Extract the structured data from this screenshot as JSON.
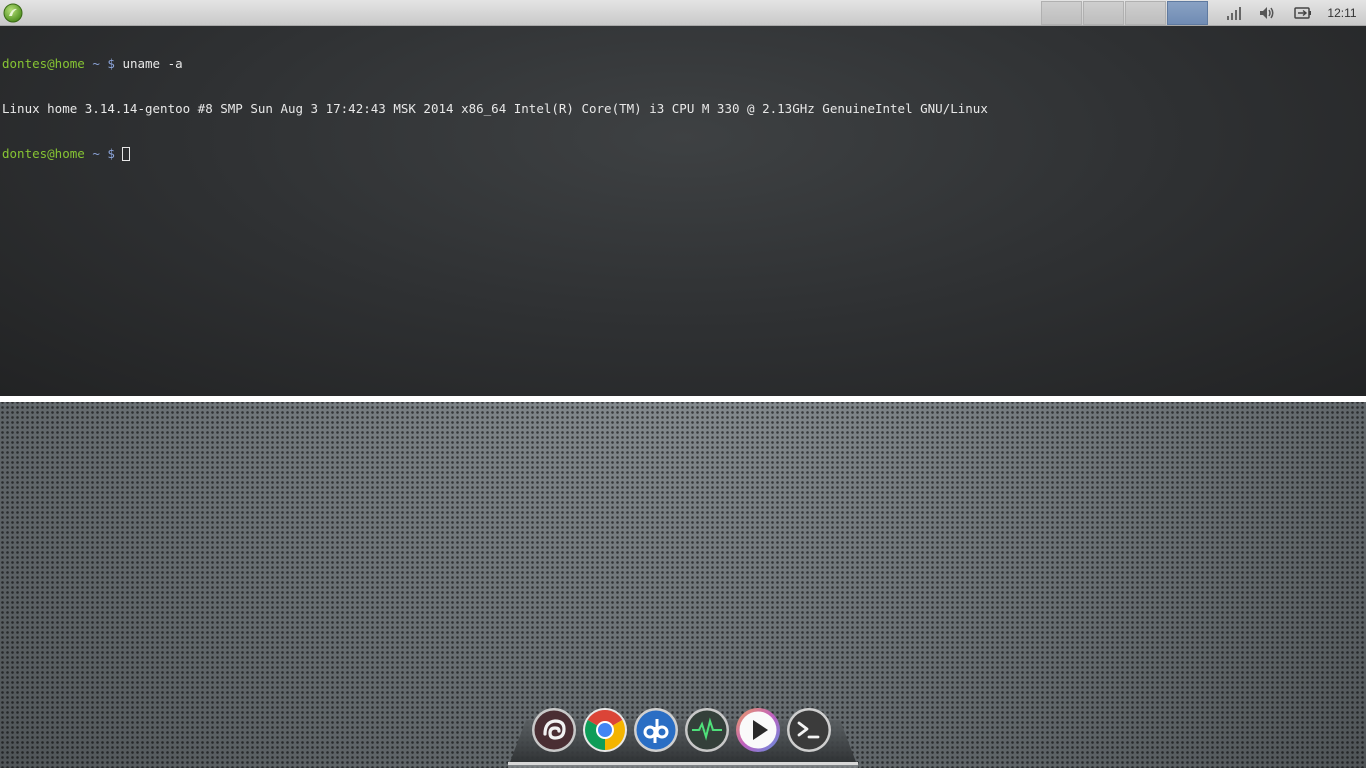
{
  "top_panel": {
    "menu_icon": "application-menu-icon",
    "workspaces": [
      {
        "index": 1,
        "active": false
      },
      {
        "index": 2,
        "active": false
      },
      {
        "index": 3,
        "active": false
      },
      {
        "index": 4,
        "active": true
      }
    ],
    "tray": [
      "network-signal-icon",
      "volume-icon",
      "battery-icon"
    ],
    "clock": "12:11"
  },
  "terminal": {
    "lines": [
      {
        "user": "dontes@home",
        "path": "~",
        "symbol": "$",
        "command": "uname -a"
      },
      {
        "output": "Linux home 3.14.14-gentoo #8 SMP Sun Aug 3 17:42:43 MSK 2014 x86_64 Intel(R) Core(TM) i3 CPU M 330 @ 2.13GHz GenuineIntel GNU/Linux"
      },
      {
        "user": "dontes@home",
        "path": "~",
        "symbol": "$",
        "command": ""
      }
    ],
    "colors": {
      "user": "#86c433",
      "path": "#8ba3d8",
      "text": "#e8e8e8"
    }
  },
  "dock": {
    "items": [
      {
        "icon": "pidgin-icon",
        "color": "#4a2e33"
      },
      {
        "icon": "chrome-icon",
        "color": "#ffffff"
      },
      {
        "icon": "qbittorrent-icon",
        "color": "#2a6ec4"
      },
      {
        "icon": "system-monitor-icon",
        "color": "#3a4a3c"
      },
      {
        "icon": "media-player-icon",
        "color": "#ffffff"
      },
      {
        "icon": "terminal-icon",
        "color": "#3b3b3b"
      }
    ]
  }
}
